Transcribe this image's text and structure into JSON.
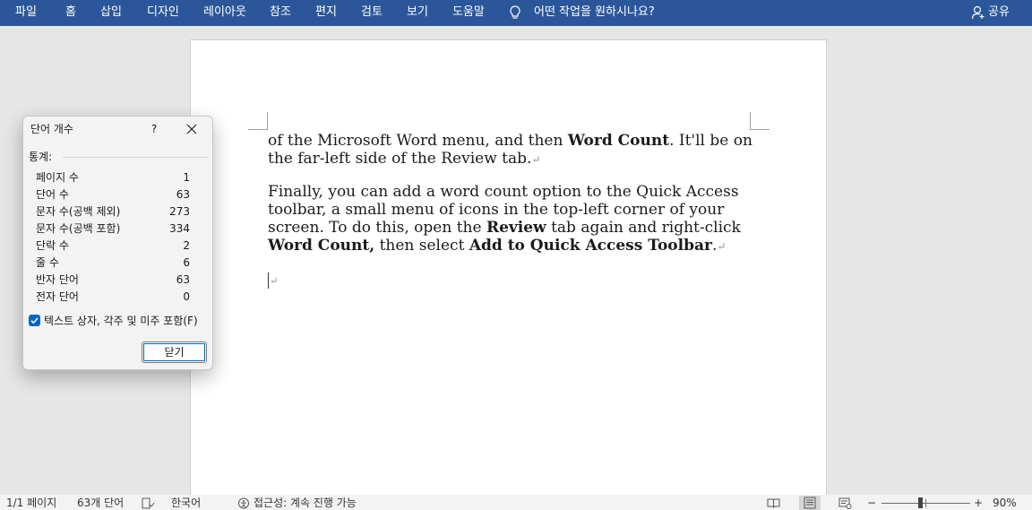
{
  "ribbon": {
    "tabs": [
      "파일",
      "홈",
      "삽입",
      "디자인",
      "레이아웃",
      "참조",
      "편지",
      "검토",
      "보기",
      "도움말"
    ],
    "tell_me": "어떤 작업을 원하시나요?",
    "share": "공유"
  },
  "document": {
    "para1": [
      {
        "t": "of the Microsoft Word menu, and then ",
        "b": false
      },
      {
        "t": "Word Count",
        "b": true
      },
      {
        "t": ". It'll be on the far-left side of the Review tab.",
        "b": false
      }
    ],
    "para2": [
      {
        "t": "Finally, you can add a word count option to the Quick Access toolbar, a small menu of icons in the top-left corner of your screen. To do this, open the ",
        "b": false
      },
      {
        "t": "Review",
        "b": true
      },
      {
        "t": " tab again and right-click ",
        "b": false
      },
      {
        "t": "Word Count,",
        "b": true
      },
      {
        "t": " then select ",
        "b": false
      },
      {
        "t": "Add to Quick Access Toolbar",
        "b": true
      },
      {
        "t": ".",
        "b": false
      }
    ],
    "paragraph_mark": "↵"
  },
  "dialog": {
    "title": "단어 개수",
    "help": "?",
    "stats_label": "통계:",
    "stats": [
      {
        "label": "페이지 수",
        "value": "1"
      },
      {
        "label": "단어 수",
        "value": "63"
      },
      {
        "label": "문자 수(공백 제외)",
        "value": "273"
      },
      {
        "label": "문자 수(공백 포함)",
        "value": "334"
      },
      {
        "label": "단락 수",
        "value": "2"
      },
      {
        "label": "줄 수",
        "value": "6"
      },
      {
        "label": "반자 단어",
        "value": "63"
      },
      {
        "label": "전자 단어",
        "value": "0"
      }
    ],
    "include_label": "텍스트 상자, 각주 및 미주 포함(F)",
    "include_checked": true,
    "close_label": "닫기"
  },
  "status": {
    "page": "1/1 페이지",
    "words": "63개 단어",
    "language": "한국어",
    "accessibility": "접근성: 계속 진행 가능",
    "zoom_minus": "−",
    "zoom_plus": "+",
    "zoom": "90%"
  }
}
